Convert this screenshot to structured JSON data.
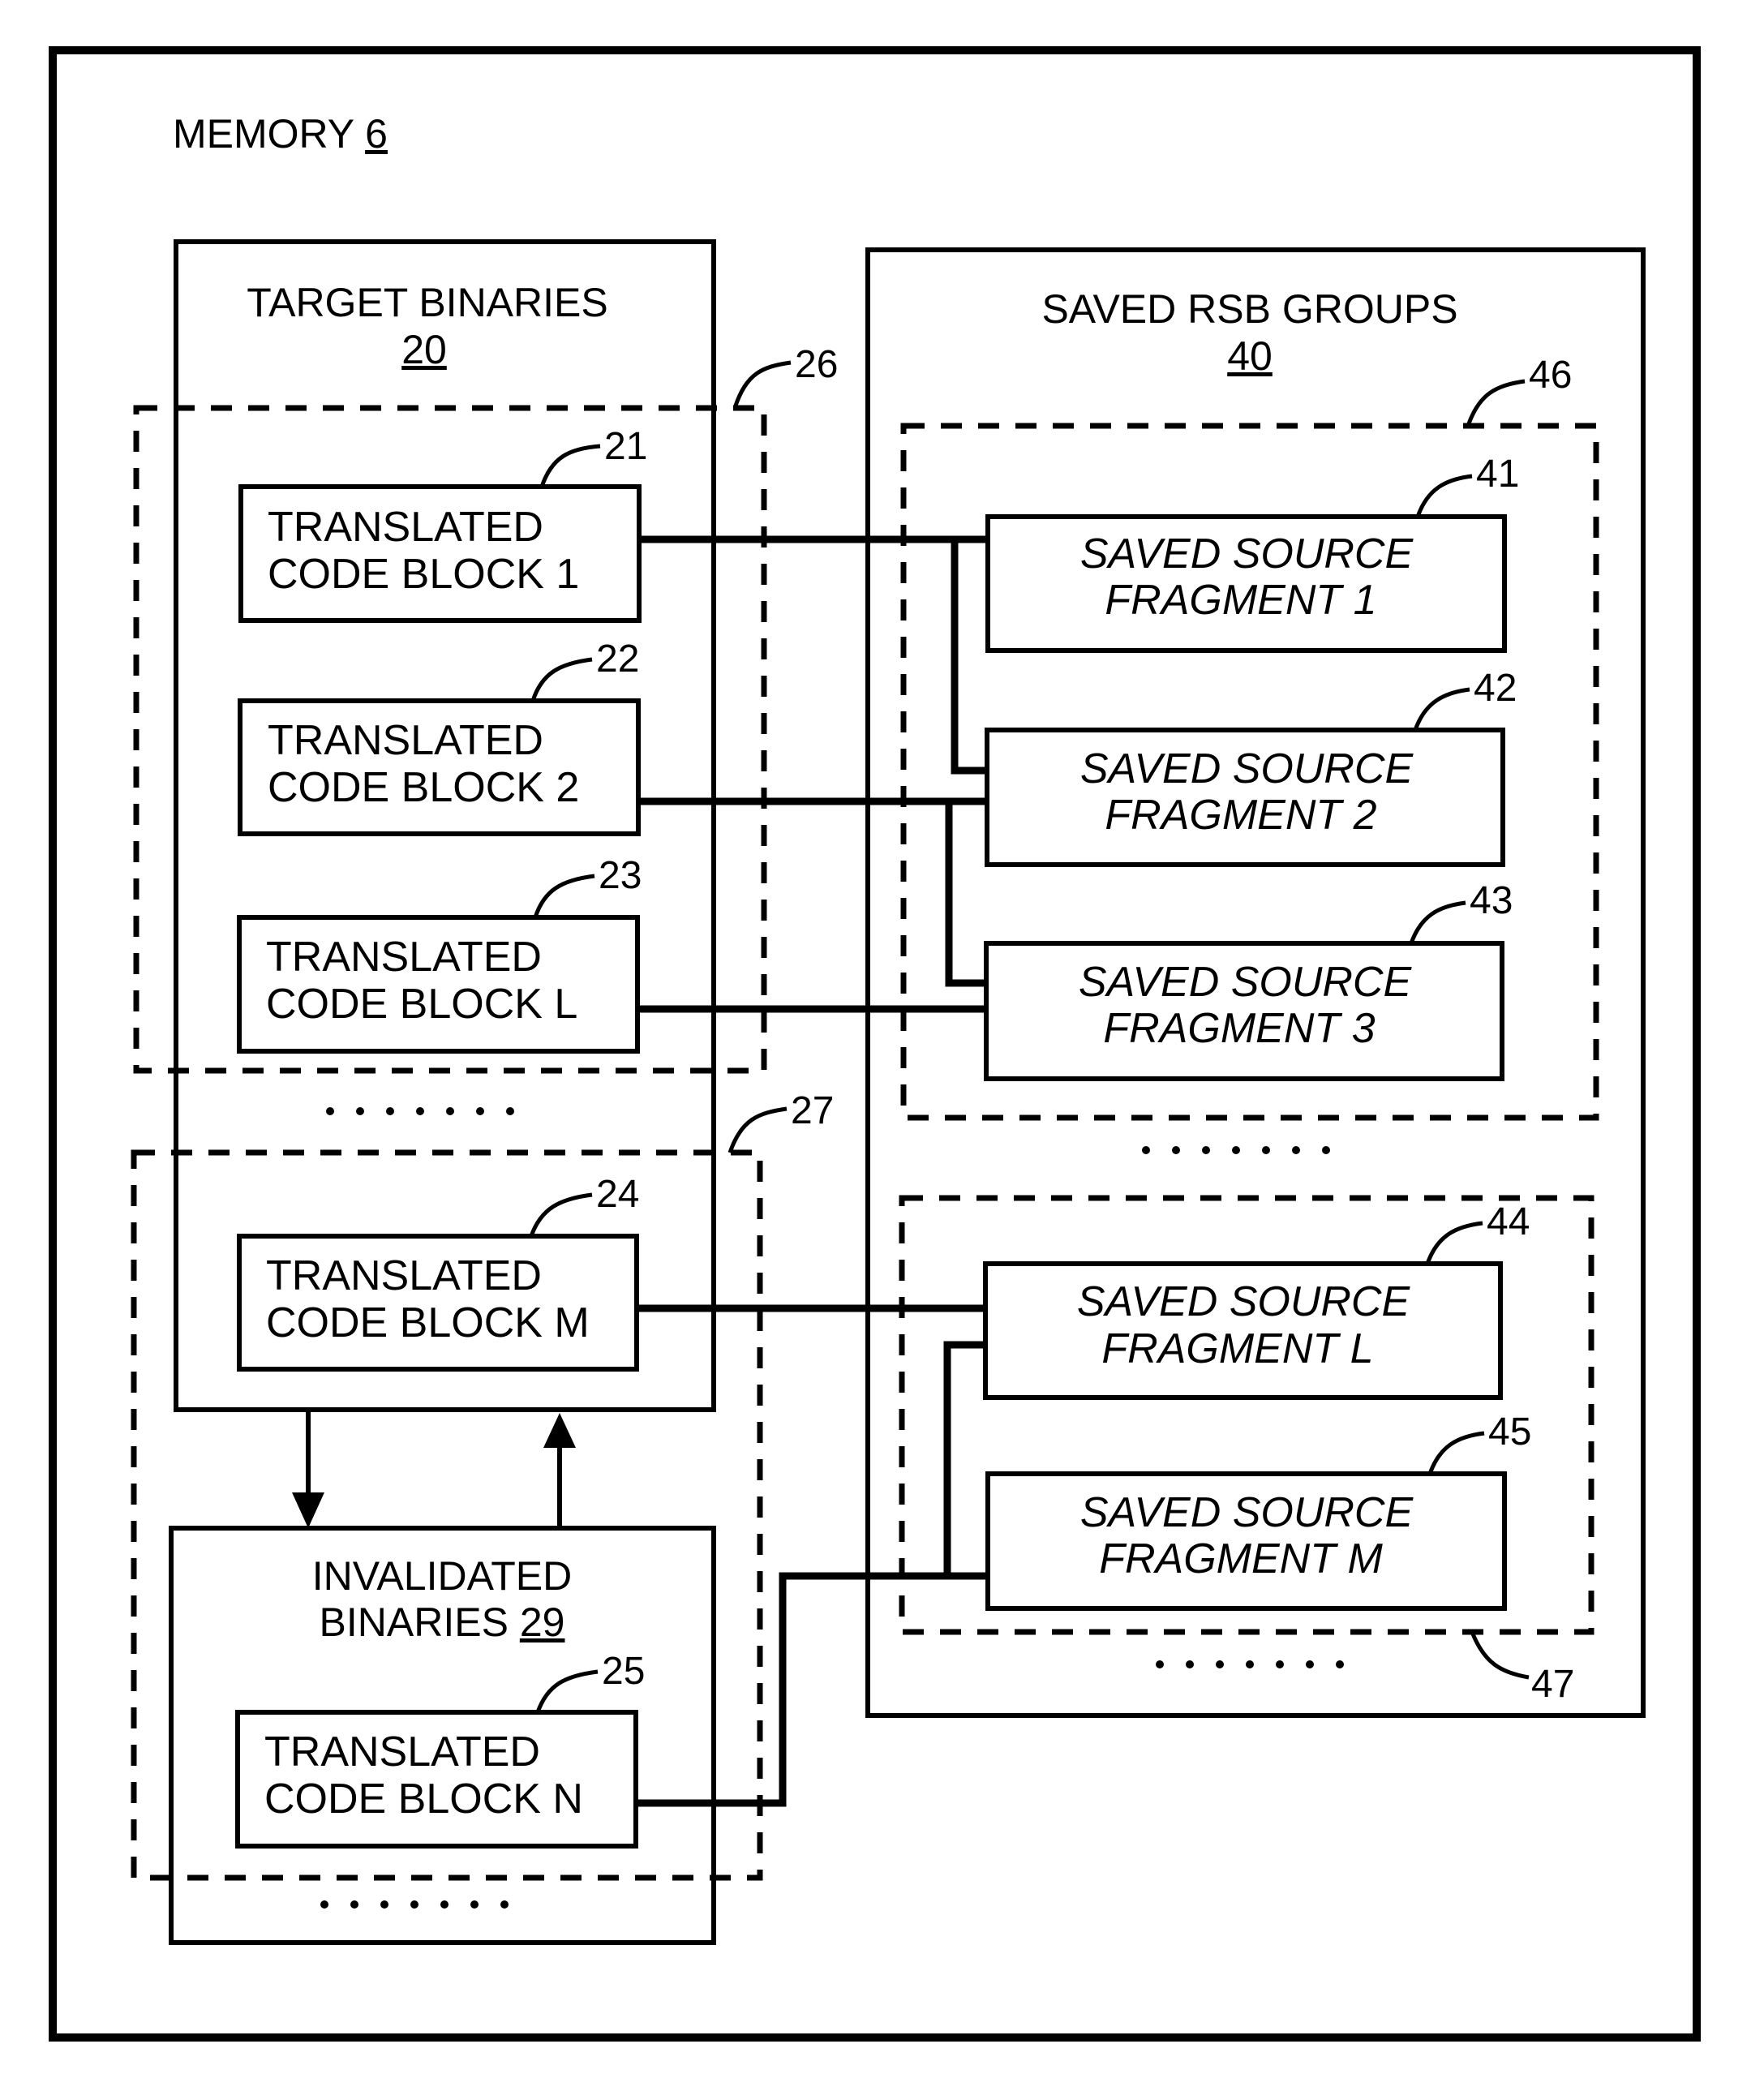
{
  "memory": {
    "label": "MEMORY",
    "ref": "6"
  },
  "target_binaries": {
    "label": "TARGET BINARIES",
    "ref": "20"
  },
  "invalidated_binaries": {
    "label_line1": "INVALIDATED",
    "label_line2": "BINARIES",
    "ref": "29"
  },
  "saved_rsb_groups": {
    "label": "SAVED RSB GROUPS",
    "ref": "40"
  },
  "groups": [
    {
      "ref": "26"
    },
    {
      "ref": "27"
    },
    {
      "ref": "46"
    },
    {
      "ref": "47"
    }
  ],
  "code_blocks": [
    {
      "line1": "TRANSLATED",
      "line2": "CODE BLOCK 1",
      "ref": "21"
    },
    {
      "line1": "TRANSLATED",
      "line2": "CODE BLOCK 2",
      "ref": "22"
    },
    {
      "line1": "TRANSLATED",
      "line2": "CODE BLOCK L",
      "ref": "23"
    },
    {
      "line1": "TRANSLATED",
      "line2": "CODE BLOCK M",
      "ref": "24"
    },
    {
      "line1": "TRANSLATED",
      "line2": "CODE BLOCK N",
      "ref": "25"
    }
  ],
  "fragments": [
    {
      "line1": "SAVED SOURCE",
      "line2": "FRAGMENT 1",
      "ref": "41"
    },
    {
      "line1": "SAVED SOURCE",
      "line2": "FRAGMENT 2",
      "ref": "42"
    },
    {
      "line1": "SAVED SOURCE",
      "line2": "FRAGMENT 3",
      "ref": "43"
    },
    {
      "line1": "SAVED SOURCE",
      "line2": "FRAGMENT L",
      "ref": "44"
    },
    {
      "line1": "SAVED SOURCE",
      "line2": "FRAGMENT M",
      "ref": "45"
    }
  ],
  "ellipsis": "......."
}
